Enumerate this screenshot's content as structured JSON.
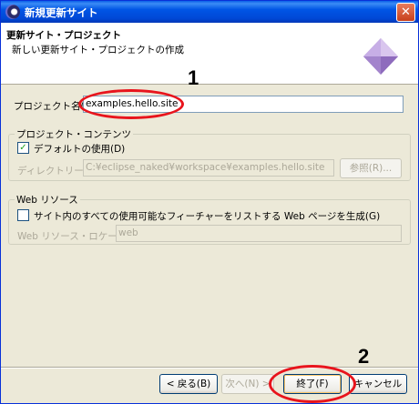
{
  "window": {
    "title": "新規更新サイト",
    "close_glyph": "✕"
  },
  "banner": {
    "title": "更新サイト・プロジェクト",
    "description": "新しい更新サイト・プロジェクトの作成"
  },
  "project_name": {
    "label": "プロジェクト名(P):",
    "value": "examples.hello.site"
  },
  "contents": {
    "group_title": "プロジェクト・コンテンツ",
    "use_default_label": "デフォルトの使用(D)",
    "use_default_checked": true,
    "check_glyph": "✓",
    "directory_label": "ディレクトリー(Y):",
    "directory_value": "C:¥eclipse_naked¥workspace¥examples.hello.site",
    "browse_label": "参照(R)..."
  },
  "web_resources": {
    "group_title": "Web リソース",
    "generate_label": "サイト内のすべての使用可能なフィーチャーをリストする Web ページを生成(G)",
    "generate_checked": false,
    "location_label": "Web リソース・ロケーション:",
    "location_value": "web"
  },
  "buttons": {
    "back": "< 戻る(B)",
    "next": "次へ(N) >",
    "finish": "終了(F)",
    "cancel": "キャンセル"
  },
  "annotations": {
    "marker_1": "1",
    "marker_2": "2",
    "color": "#e8141c"
  }
}
